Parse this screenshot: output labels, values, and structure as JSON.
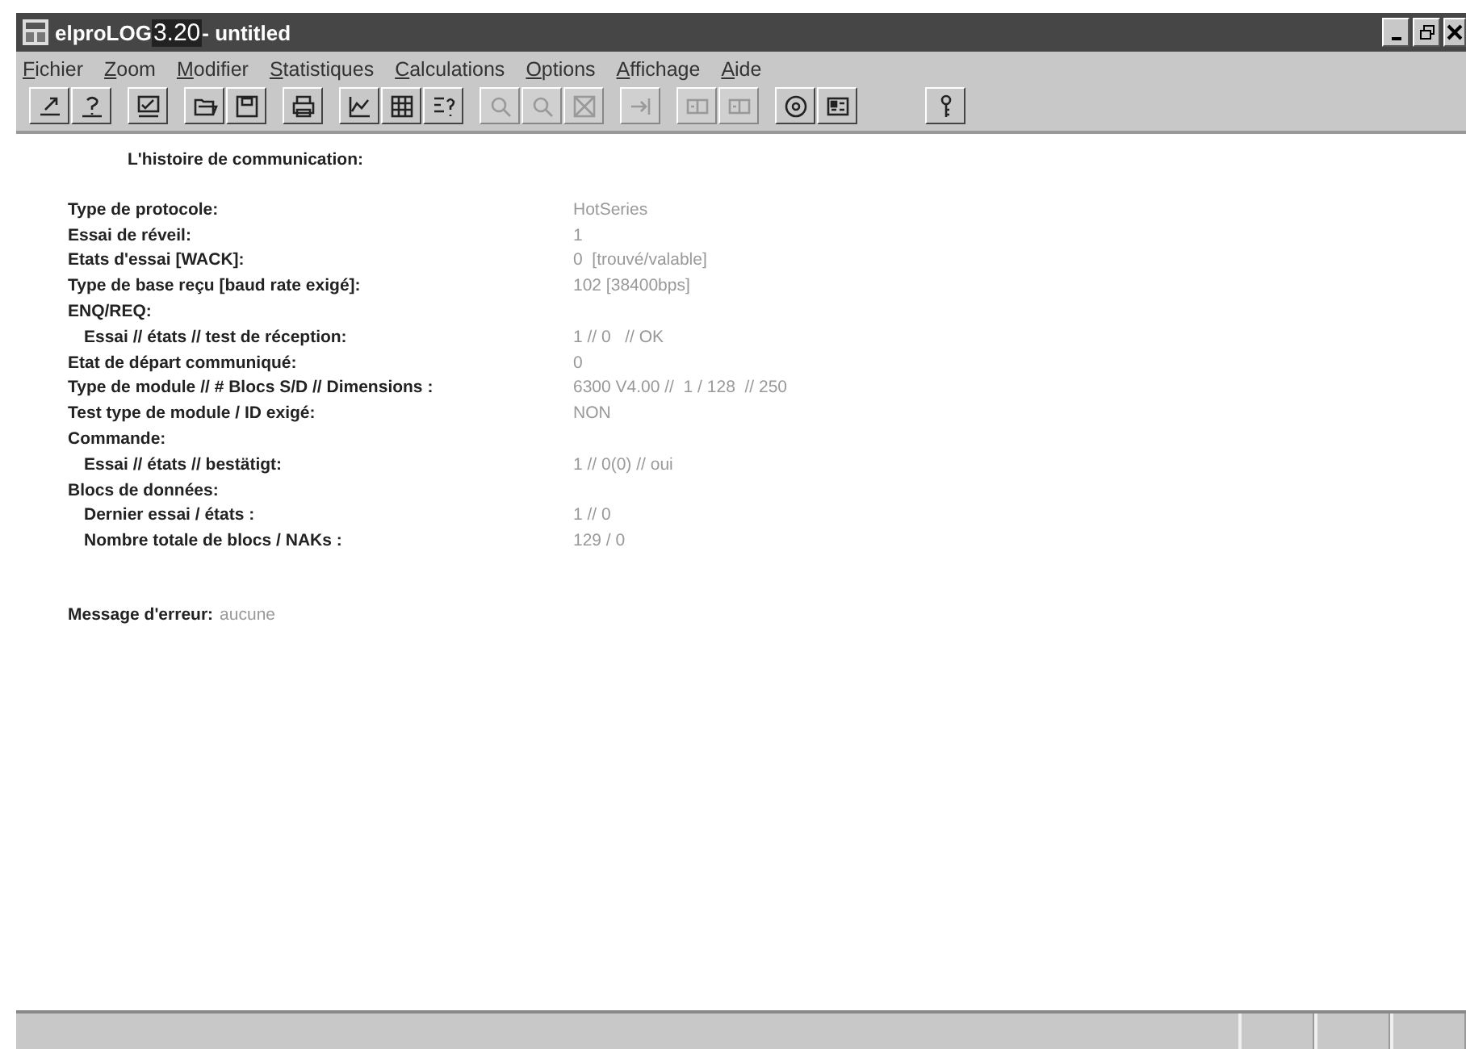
{
  "window": {
    "app_name": "elproLOG",
    "version": "3.20",
    "document": "- untitled"
  },
  "menu": [
    "Fichier",
    "Zoom",
    "Modifier",
    "Statistiques",
    "Calculations",
    "Options",
    "Affichage",
    "Aide"
  ],
  "toolbar": [
    [
      {
        "kind": "export",
        "disabled": false
      },
      {
        "kind": "help",
        "disabled": false
      }
    ],
    [
      {
        "kind": "check",
        "disabled": false
      }
    ],
    [
      {
        "kind": "open",
        "disabled": false
      },
      {
        "kind": "save",
        "disabled": false
      }
    ],
    [
      {
        "kind": "print",
        "disabled": false
      }
    ],
    [
      {
        "kind": "chart",
        "disabled": false
      },
      {
        "kind": "table",
        "disabled": false
      },
      {
        "kind": "query",
        "disabled": false
      }
    ],
    [
      {
        "kind": "zoom",
        "disabled": true
      },
      {
        "kind": "zoom",
        "disabled": true
      },
      {
        "kind": "cross",
        "disabled": true
      }
    ],
    [
      {
        "kind": "goto",
        "disabled": true
      }
    ],
    [
      {
        "kind": "module",
        "disabled": true
      },
      {
        "kind": "module",
        "disabled": true
      }
    ],
    [
      {
        "kind": "circle",
        "disabled": false
      },
      {
        "kind": "grid",
        "disabled": false
      }
    ],
    [
      {
        "kind": "key",
        "disabled": false
      }
    ]
  ],
  "heading": "L'histoire de communication:",
  "rows": [
    {
      "label": "Type de protocole:",
      "value": "HotSeries"
    },
    {
      "label": "Essai de réveil:",
      "value": "1"
    },
    {
      "label": "Etats d'essai [WACK]:",
      "value": "0  [trouvé/valable]"
    },
    {
      "label": "Type de base reçu [baud rate exigé]:",
      "value": "102 [38400bps]"
    },
    {
      "label": "ENQ/REQ:",
      "children": [
        {
          "label": "Essai // états // test de réception:",
          "value": "1 // 0   // OK"
        }
      ]
    },
    {
      "label": "Etat de départ communiqué:",
      "value": "0"
    },
    {
      "label": "Type de module // # Blocs S/D // Dimensions :",
      "value": "6300 V4.00 //  1 / 128  // 250"
    },
    {
      "label": "Test type de module / ID exigé:",
      "value": "NON"
    },
    {
      "label": "Commande:",
      "children": [
        {
          "label": "Essai // états // bestätigt:",
          "value": "1 // 0(0) // oui"
        }
      ]
    },
    {
      "label": "Blocs de données:",
      "children": [
        {
          "label": "Dernier essai / états :",
          "value": "1 // 0"
        },
        {
          "label": "Nombre totale de blocs / NAKs :",
          "value": "129 / 0"
        }
      ]
    }
  ],
  "error": {
    "label": "Message d'erreur:",
    "value": "aucune"
  }
}
